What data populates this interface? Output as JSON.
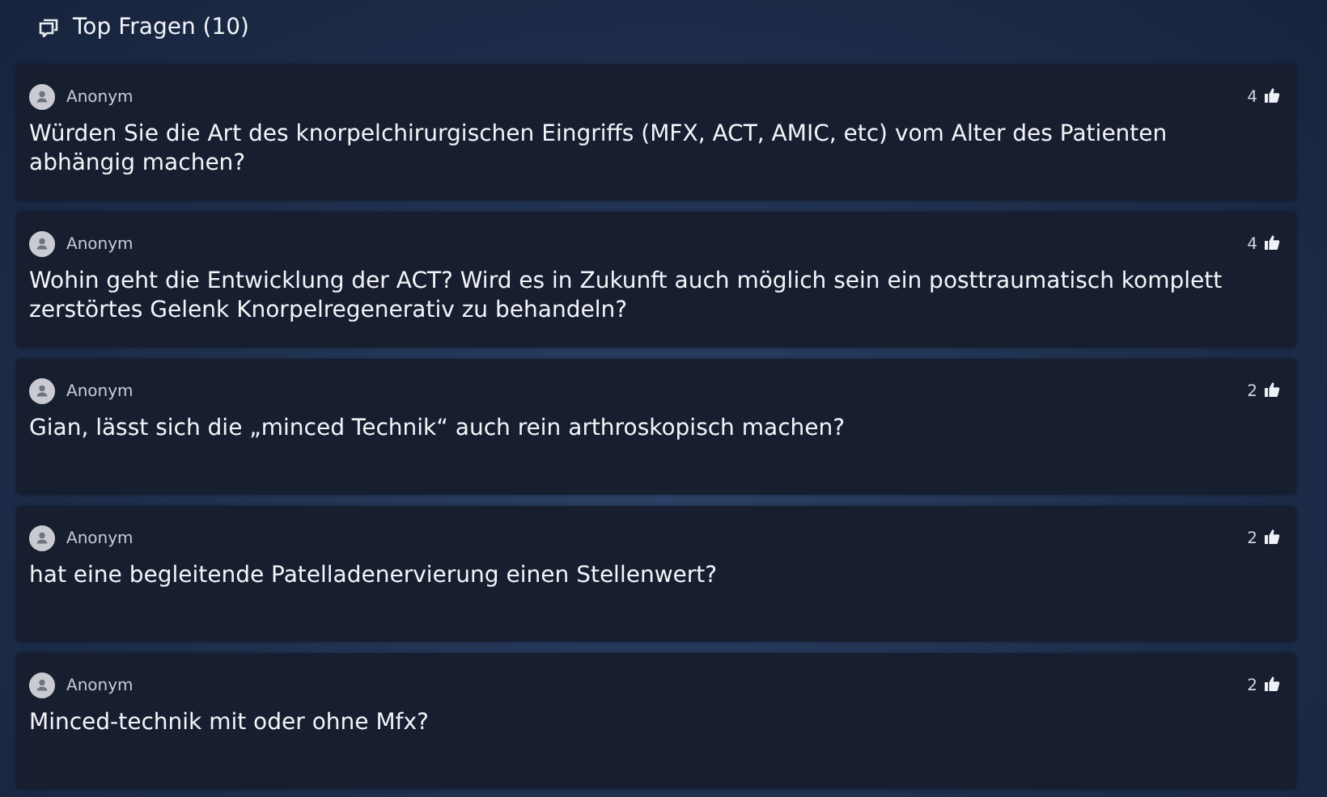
{
  "header": {
    "title": "Top Fragen (10)"
  },
  "questions": [
    {
      "author": "Anonym",
      "likes": "4",
      "text": "Würden Sie die Art des knorpelchirurgischen Eingriffs (MFX, ACT, AMIC, etc) vom Alter des Patienten abhängig machen?"
    },
    {
      "author": "Anonym",
      "likes": "4",
      "text": "Wohin geht die Entwicklung der ACT? Wird es in Zukunft auch möglich sein ein posttraumatisch komplett zerstörtes Gelenk Knorpelregenerativ zu behandeln?"
    },
    {
      "author": "Anonym",
      "likes": "2",
      "text": "Gian, lässt sich die „minced Technik“ auch rein arthroskopisch machen?"
    },
    {
      "author": "Anonym",
      "likes": "2",
      "text": "hat eine begleitende Patelladenervierung einen Stellenwert?"
    },
    {
      "author": "Anonym",
      "likes": "2",
      "text": "Minced-technik mit oder ohne Mfx?"
    }
  ]
}
